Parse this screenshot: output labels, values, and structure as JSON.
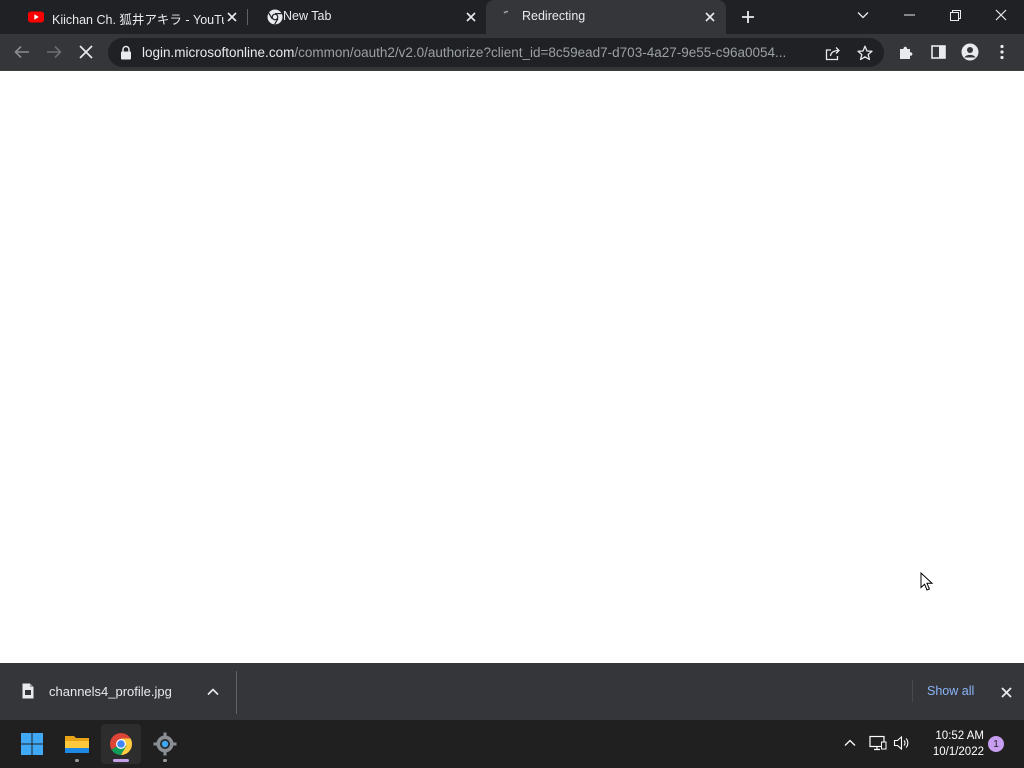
{
  "browser": {
    "tabs": [
      {
        "title": "Kiichan Ch. 狐井アキラ - YouTube",
        "favicon": "youtube-icon",
        "active": false
      },
      {
        "title": "New Tab",
        "favicon": "chrome-icon",
        "active": false
      },
      {
        "title": "Redirecting",
        "favicon": "loading-spinner-icon",
        "active": true
      }
    ],
    "address_bar": {
      "host": "login.microsoftonline.com",
      "path": "/common/oauth2/v2.0/authorize?client_id=8c59ead7-d703-4a27-9e55-c96a0054..."
    },
    "page_state": "loading"
  },
  "download_bar": {
    "file_name": "channels4_profile.jpg",
    "show_all_label": "Show all"
  },
  "taskbar": {
    "apps": [
      "start-icon",
      "file-explorer-icon",
      "chrome-icon",
      "settings-icon"
    ],
    "clock": {
      "time": "10:52 AM",
      "date": "10/1/2022"
    },
    "notification_count": "1"
  },
  "colors": {
    "tabstrip": "#202124",
    "toolbar": "#35363a",
    "link_blue": "#8ab4f8",
    "youtube_red": "#ff0000",
    "windows_blue": "#3fa9f5"
  }
}
